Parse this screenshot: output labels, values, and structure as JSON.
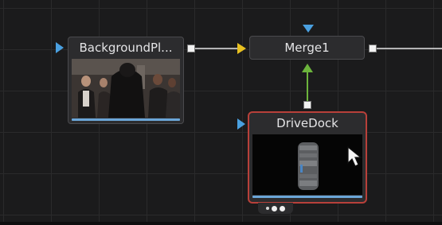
{
  "nodes": {
    "background": {
      "label": "BackgroundPl..."
    },
    "merge": {
      "label": "Merge1"
    },
    "drivedock": {
      "label": "DriveDock"
    }
  },
  "colors": {
    "selected_border": "#b8403a",
    "input_background_arrow": "#e8c020",
    "input_foreground_arrow": "#6cb43c",
    "input_effect_arrow": "#4aa0e0",
    "output_port": "#f2f2f2",
    "node_status_stripe": "#6ba6d8"
  },
  "icons": {
    "cursor": "mouse-pointer-icon",
    "view_toggles": "view-dots-icon"
  }
}
